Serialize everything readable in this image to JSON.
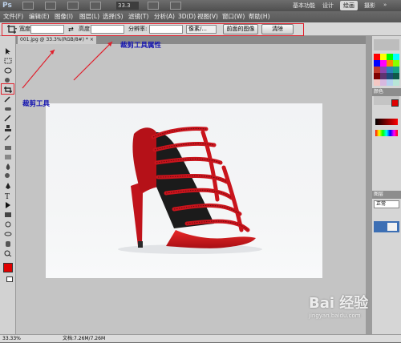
{
  "app_bar": {
    "logo": "Ps",
    "zoom": "33.3",
    "workspaces": [
      "基本功能",
      "设计",
      "绘画",
      "摄影"
    ],
    "active_workspace": "绘画"
  },
  "menu": [
    "文件(F)",
    "编辑(E)",
    "图像(I)",
    "图层(L)",
    "选择(S)",
    "滤镜(T)",
    "分析(A)",
    "3D(D)",
    "视图(V)",
    "窗口(W)",
    "帮助(H)"
  ],
  "options_bar": {
    "width_label": "宽度:",
    "height_label": "高度:",
    "resolution_label": "分辨率:",
    "unit_value": "像素/...",
    "front_image_button": "前面的图像",
    "clear_button": "清除"
  },
  "document_tab": "001.jpg @ 33.3%(RGB/8#) * ×",
  "status_bar": {
    "zoom": "33.33%",
    "doc_info": "文档:7.26M/7.26M"
  },
  "panels": {
    "colors_header": "颜色",
    "layers_header": "图层",
    "layer_mode": "正常"
  },
  "annotations": {
    "crop_tool": "裁剪工具",
    "crop_tool_properties": "裁剪工具属性"
  },
  "watermark": {
    "brand": "Bai 经验",
    "url": "jingyan.baidu.com"
  },
  "colors": {
    "highlight": "#e0202c",
    "annotation": "#1414b0",
    "foreground": "#e00000"
  }
}
